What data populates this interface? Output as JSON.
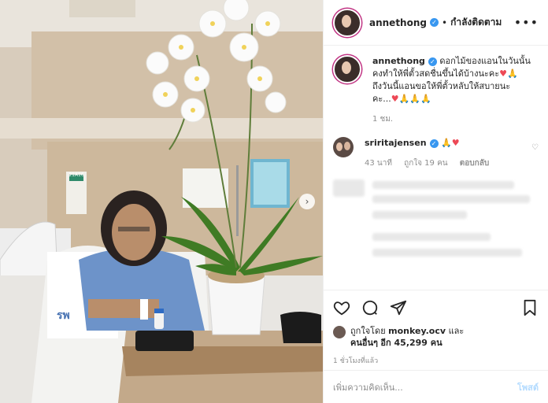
{
  "post": {
    "username": "annethong",
    "follow_label": "กำลังติดตาม",
    "more_label": "•••",
    "caption_line1": "ดอกไม้ของแอนในวันนั้น",
    "caption_line2": "คงทำให้พี่ตั้วสดชื่นขึ้นได้บ้างนะคะ",
    "caption_line3": "ถึงวันนี้แอนขอให้พี่ตั้วหลับให้สบายนะ",
    "caption_line4": "คะ...",
    "caption_time": "1 ชม."
  },
  "comment": {
    "username": "sriritajensen",
    "time": "43 นาที",
    "likes": "ถูกใจ 19 คน",
    "reply": "ตอบกลับ"
  },
  "engagement": {
    "liked_by_prefix": "ถูกใจโดย",
    "liked_by_user": "monkey.ocv",
    "and_label": "และ",
    "others_prefix": "คนอื่นๆ",
    "others_count": "อีก 45,299 คน",
    "timestamp": "1 ชั่วโมงที่แล้ว"
  },
  "composer": {
    "placeholder": "เพิ่มความคิดเห็น...",
    "post_label": "โพสต์"
  },
  "photo": {
    "room_sign": "21A16",
    "sheet_text": "รพ"
  },
  "colors": {
    "verified": "#3897f0",
    "heart": "#ed4956",
    "post_button": "#b3dbff"
  }
}
